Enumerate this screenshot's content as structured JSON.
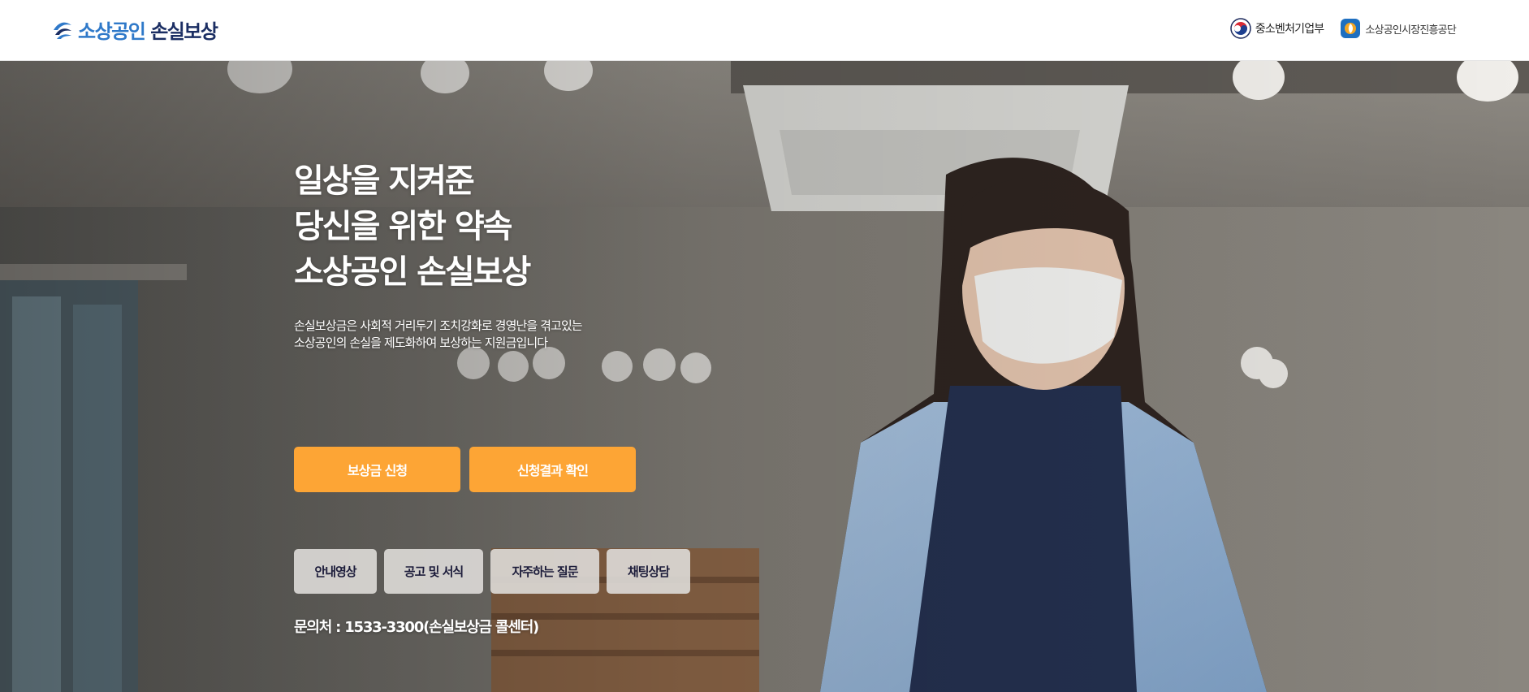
{
  "header": {
    "logo": {
      "part1": "소상공인",
      "part2": "손실보상"
    },
    "partners": [
      {
        "name": "중소벤처기업부",
        "icon": "taegeuk-emblem-icon"
      },
      {
        "name": "소상공인시장진흥공단",
        "icon": "semas-emblem-icon"
      }
    ]
  },
  "hero": {
    "headline": [
      "일상을 지켜준",
      "당신을 위한 약속",
      "소상공인 손실보상"
    ],
    "subtext": [
      "손실보상금은 사회적 거리두기 조치강화로 경영난을 겪고있는",
      "소상공인의 손실을 제도화하여 보상하는 지원금입니다"
    ],
    "cta": {
      "apply": "보상금 신청",
      "result": "신청결과 확인"
    },
    "sub_buttons": {
      "video": "안내영상",
      "notice": "공고 및 서식",
      "faq": "자주하는 질문",
      "chat": "채팅상담"
    },
    "contact": "문의처 : 1533-3300(손실보상금 콜센터)"
  },
  "colors": {
    "accent_orange": "#fda535",
    "logo_blue": "#2f79c9",
    "logo_navy": "#1b2e63",
    "sub_button_bg": "#dedcd8",
    "sub_button_text": "#1c1c3a"
  }
}
